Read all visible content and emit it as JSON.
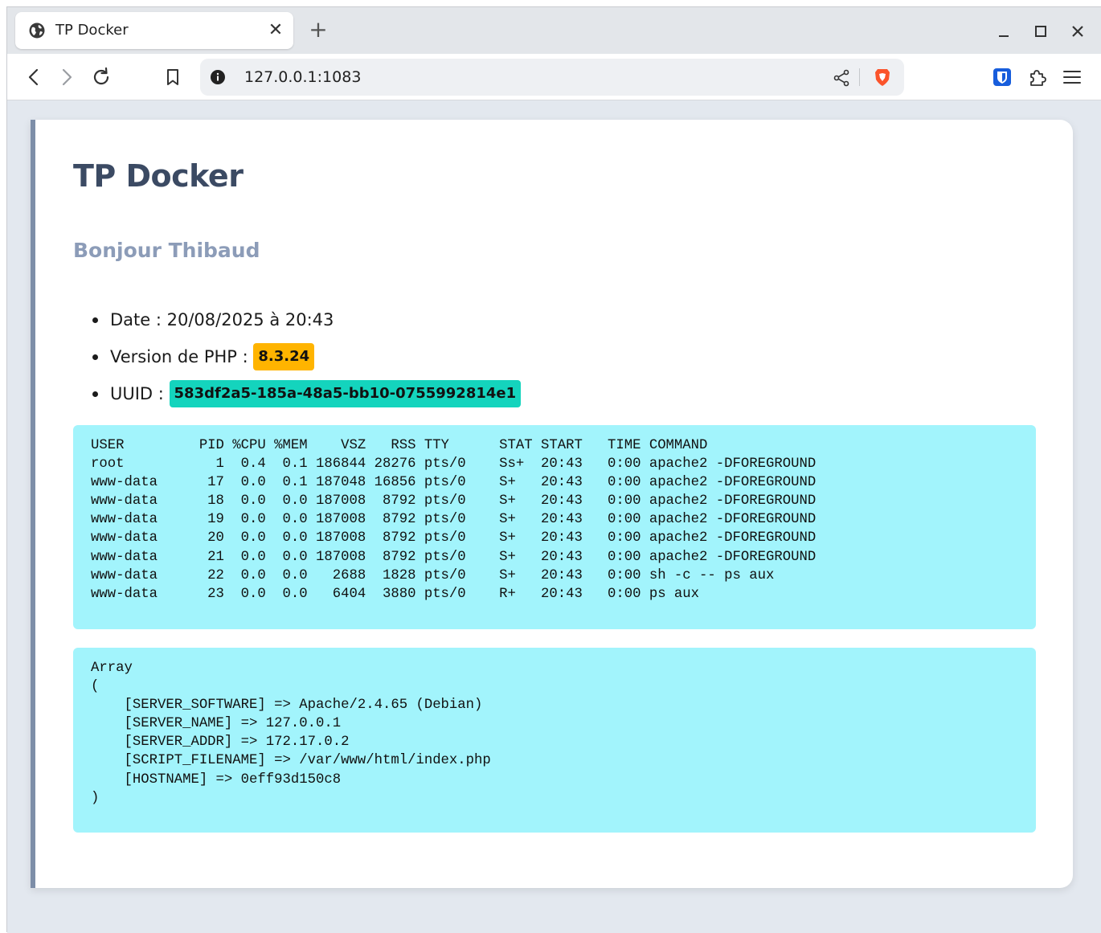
{
  "browser": {
    "tab": {
      "title": "TP Docker",
      "close": "✕"
    },
    "new_tab": "+",
    "window_controls": {
      "minimize": "–",
      "maximize": "☐",
      "close": "✕"
    },
    "address": "127.0.0.1:1083"
  },
  "page": {
    "title": "TP Docker",
    "greeting": "Bonjour Thibaud",
    "info": {
      "date_label": "Date : ",
      "date_value": "20/08/2025 à 20:43",
      "php_label": "Version de PHP : ",
      "php_version": "8.3.24",
      "uuid_label": "UUID : ",
      "uuid_value": "583df2a5-185a-48a5-bb10-0755992814e1"
    },
    "colors": {
      "php_badge": "#ffb400",
      "uuid_badge": "#14d4bd",
      "code_bg": "#a2f4fc"
    },
    "ps_output": "USER         PID %CPU %MEM    VSZ   RSS TTY      STAT START   TIME COMMAND\nroot           1  0.4  0.1 186844 28276 pts/0    Ss+  20:43   0:00 apache2 -DFOREGROUND\nwww-data      17  0.0  0.1 187048 16856 pts/0    S+   20:43   0:00 apache2 -DFOREGROUND\nwww-data      18  0.0  0.0 187008  8792 pts/0    S+   20:43   0:00 apache2 -DFOREGROUND\nwww-data      19  0.0  0.0 187008  8792 pts/0    S+   20:43   0:00 apache2 -DFOREGROUND\nwww-data      20  0.0  0.0 187008  8792 pts/0    S+   20:43   0:00 apache2 -DFOREGROUND\nwww-data      21  0.0  0.0 187008  8792 pts/0    S+   20:43   0:00 apache2 -DFOREGROUND\nwww-data      22  0.0  0.0   2688  1828 pts/0    S+   20:43   0:00 sh -c -- ps aux\nwww-data      23  0.0  0.0   6404  3880 pts/0    R+   20:43   0:00 ps aux",
    "server_array": "Array\n(\n    [SERVER_SOFTWARE] => Apache/2.4.65 (Debian)\n    [SERVER_NAME] => 127.0.0.1\n    [SERVER_ADDR] => 172.17.0.2\n    [SCRIPT_FILENAME] => /var/www/html/index.php\n    [HOSTNAME] => 0eff93d150c8\n)"
  }
}
